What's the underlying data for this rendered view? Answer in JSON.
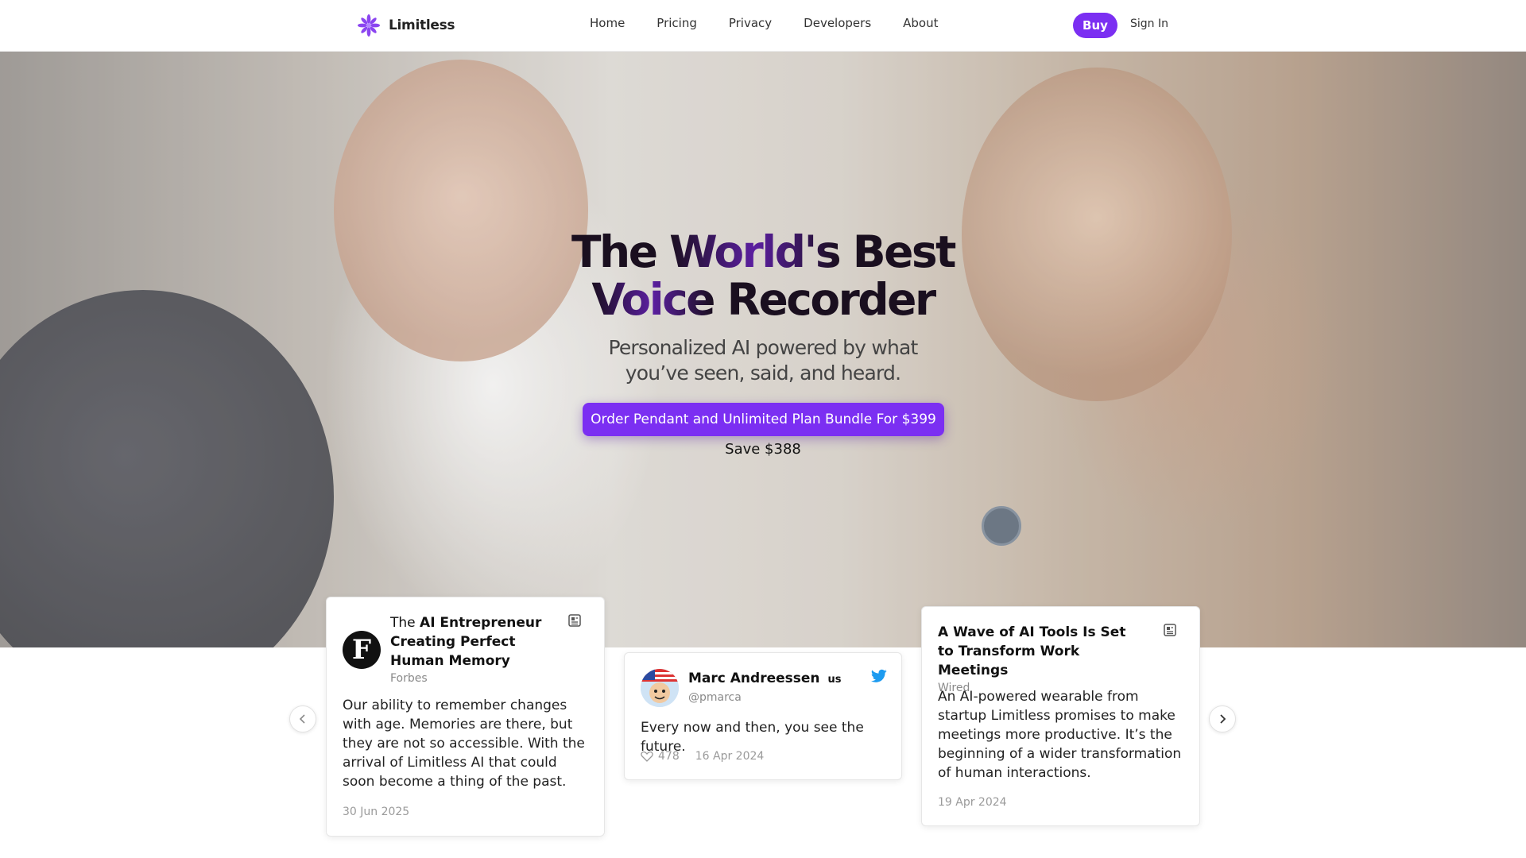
{
  "nav": {
    "brand": "Limitless",
    "links": [
      "Home",
      "Pricing",
      "Privacy",
      "Developers",
      "About"
    ],
    "buy_label": "Buy",
    "signin_label": "Sign In"
  },
  "hero": {
    "title_line1_a": "The ",
    "title_line1_b": "World's",
    "title_line1_c": " Best",
    "title_line2_a": "Voice",
    "title_line2_b": " Recorder",
    "subtitle_line1": "Personalized AI powered by what",
    "subtitle_line2": "you’ve seen, said, and heard.",
    "cta_label": "Order Pendant and Unlimited Plan Bundle For $399",
    "save_text": "Save $388"
  },
  "cards": [
    {
      "title_prefix": "The ",
      "title": "AI Entrepreneur Creating Perfect Human Memory",
      "logo_letter": "F",
      "source": "Forbes",
      "body": "Our ability to remember changes with age. Memories are there, but they are not so accessible. With the arrival of Limitless AI that could soon become a thing of the past.",
      "date": "30 Jun 2025"
    },
    {
      "name": "Marc Andreessen",
      "flag": "us",
      "handle": "@pmarca",
      "body": "Every now and then, you see the future.",
      "likes": "478",
      "date": "16 Apr 2024"
    },
    {
      "title": "A Wave of AI Tools Is Set to Transform Work Meetings",
      "source": "Wired",
      "body": "An AI-powered wearable from startup Limitless promises to make meetings more productive. It’s the beginning of a wider transformation of human interactions.",
      "date": "19 Apr 2024"
    }
  ],
  "colors": {
    "accent": "#7b2ff2",
    "twitter": "#1d9bf0"
  },
  "icons": [
    "limitless-logo-icon",
    "document-icon",
    "twitter-icon",
    "heart-icon",
    "chevron-left-icon",
    "chevron-right-icon"
  ]
}
